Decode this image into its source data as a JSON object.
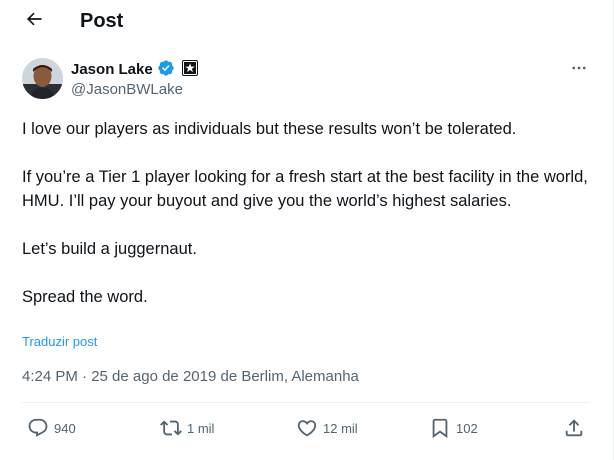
{
  "header": {
    "title": "Post"
  },
  "author": {
    "name": "Jason Lake",
    "handle": "@JasonBWLake"
  },
  "post": {
    "paragraphs": [
      "I love our players as individuals but these results won’t be tolerated.",
      "If you’re a Tier 1 player looking for a fresh start at the best facility in the world, HMU.  I’ll pay your buyout and give you the world’s highest salaries.",
      "Let’s build a juggernaut.",
      "Spread the word."
    ],
    "translate_label": "Traduzir post",
    "timestamp": "4:24 PM · 25 de ago de 2019 de Berlim, Alemanha"
  },
  "actions": {
    "replies": "940",
    "reposts": "1 mil",
    "likes": "12 mil",
    "bookmarks": "102"
  },
  "colors": {
    "accent": "#1d9bf0",
    "text": "#0f1419",
    "muted": "#536471",
    "divider": "#eff3f4"
  },
  "icons": {
    "back": "arrow-left-icon",
    "verified": "verified-badge-icon",
    "affiliate": "star-badge-icon",
    "more": "more-horizontal-icon",
    "reply": "reply-icon",
    "repost": "repost-icon",
    "like": "heart-icon",
    "bookmark": "bookmark-icon",
    "share": "share-icon"
  }
}
